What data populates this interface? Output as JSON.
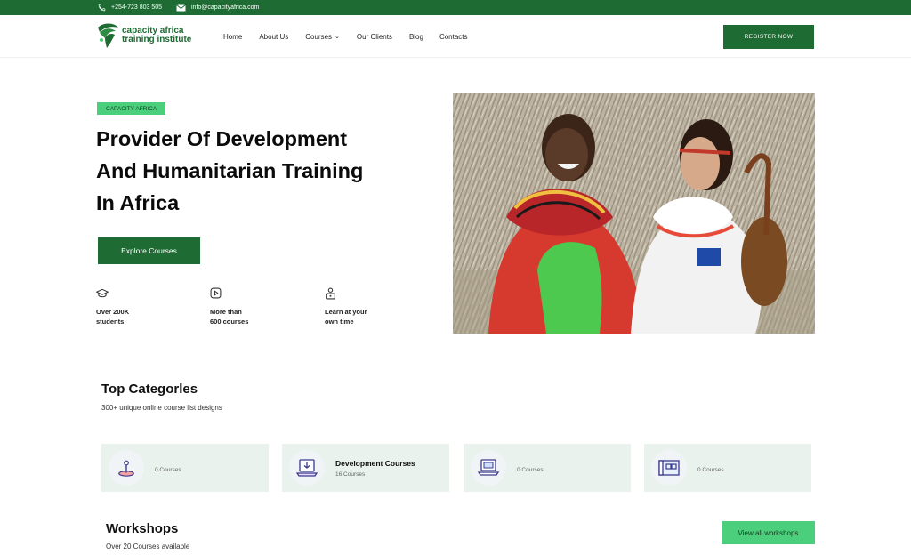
{
  "topbar": {
    "phone": "+254-723 803 505",
    "email": "info@capacityafrica.com"
  },
  "logo": {
    "line1": "capacity africa",
    "line2": "training institute"
  },
  "nav": {
    "items": [
      {
        "label": "Home"
      },
      {
        "label": "About Us"
      },
      {
        "label": "Courses"
      },
      {
        "label": "Our Clients"
      },
      {
        "label": "Blog"
      },
      {
        "label": "Contacts"
      }
    ],
    "register_label": "REGISTER NOW"
  },
  "hero": {
    "badge": "CAPACITY AFRICA",
    "title_line1": "Provider Of Development",
    "title_line2": "And Humanitarian Training",
    "title_line3": "In Africa",
    "cta_label": "Explore Courses",
    "features": [
      {
        "line1": "Over 200K",
        "line2": "students",
        "icon": "graduation-cap-icon"
      },
      {
        "line1": "More than",
        "line2": "600 courses",
        "icon": "play-video-icon"
      },
      {
        "line1": "Learn at your",
        "line2": "own time",
        "icon": "user-lock-icon"
      }
    ]
  },
  "categories": {
    "title": "Top Categorles",
    "subtitle": "300+ unique online course list designs",
    "cards": [
      {
        "name": "",
        "count": "0 Courses",
        "icon": "joystick-icon"
      },
      {
        "name": "Development Courses",
        "count": "16 Courses",
        "icon": "laptop-download-icon"
      },
      {
        "name": "",
        "count": "0 Courses",
        "icon": "laptop-code-icon"
      },
      {
        "name": "",
        "count": "0 Courses",
        "icon": "blueprint-icon"
      }
    ]
  },
  "workshops": {
    "title": "Workshops",
    "subtitle": "Over 20 Courses available",
    "cta_label": "View all workshops"
  },
  "colors": {
    "brand_green": "#1e6b33",
    "accent_green": "#4ccf7d",
    "card_bg": "#e9f2ec"
  }
}
